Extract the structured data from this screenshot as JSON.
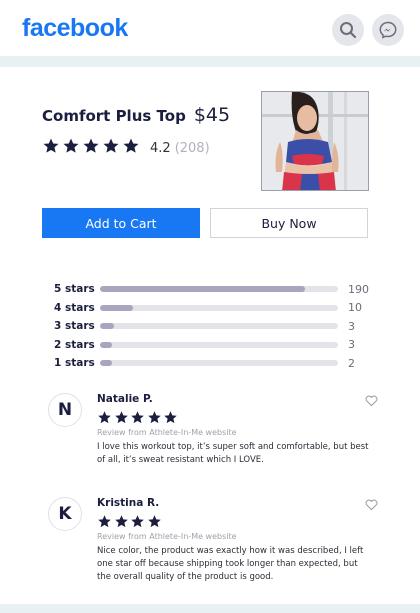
{
  "header": {
    "logo_text": "facebook",
    "search_icon": "search-icon",
    "messenger_icon": "messenger-icon"
  },
  "product": {
    "title": "Comfort Plus Top",
    "price": "$45",
    "rating_value": "4.2",
    "rating_count": "(208)",
    "stars_filled": 5,
    "image_icon": "product-photo"
  },
  "actions": {
    "add_to_cart": "Add to Cart",
    "buy_now": "Buy Now"
  },
  "rating_breakdown": [
    {
      "label": "5 stars",
      "count": "190",
      "fraction": 0.86
    },
    {
      "label": "4 stars",
      "count": "10",
      "fraction": 0.14
    },
    {
      "label": "3 stars",
      "count": "3",
      "fraction": 0.06
    },
    {
      "label": "2 stars",
      "count": "3",
      "fraction": 0.05
    },
    {
      "label": "1 stars",
      "count": "2",
      "fraction": 0.05
    }
  ],
  "reviews": [
    {
      "initial": "N",
      "name": "Natalie P.",
      "stars": 5,
      "source": "Review from Athlete-In-Me website",
      "text": "I love this workout top, it’s super soft and comfortable, but best of all, it’s sweat resistant which I LOVE."
    },
    {
      "initial": "K",
      "name": "Kristina R.",
      "stars": 4,
      "source": "Review from Athlete-In-Me website",
      "text": "Nice color, the product was exactly how it was described, I left one star off because shipping took longer than expected, but the overall quality of the product is good."
    }
  ],
  "colors": {
    "brand": "#1877f2",
    "text_dark": "#1c1e3f",
    "bar_fill": "#a9a5be",
    "bar_track": "#e2e4e8"
  }
}
